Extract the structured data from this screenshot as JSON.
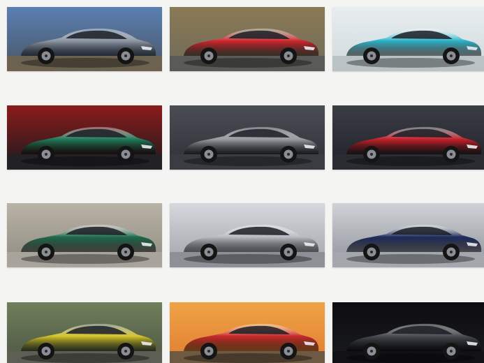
{
  "gallery": {
    "tiles": [
      {
        "subject": "silver-roadster-coast",
        "body": "#8e97a4",
        "bg_top": "#5a7fb3",
        "bg_bottom": "#4b5563",
        "ground": "#6b6250"
      },
      {
        "subject": "red-convertible-supercar",
        "body": "#d3262e",
        "bg_top": "#8a7a55",
        "bg_bottom": "#6f6a5a",
        "ground": "#5a5a56"
      },
      {
        "subject": "teal-electric-race-car",
        "body": "#2bb3c9",
        "bg_top": "#e8eef0",
        "bg_bottom": "#cfd8db",
        "ground": "#b9c3c6"
      },
      {
        "subject": "green-sports-coupe",
        "body": "#1f7d5c",
        "bg_top": "#8a1b1b",
        "bg_bottom": "#1b1b1e",
        "ground": "#222226"
      },
      {
        "subject": "grey-wedge-supercar",
        "body": "#9a9da3",
        "bg_top": "#4a4d55",
        "bg_bottom": "#2e3036",
        "ground": "#3a3c42"
      },
      {
        "subject": "red-supercar-front",
        "body": "#c8202a",
        "bg_top": "#3a3d45",
        "bg_bottom": "#202228",
        "ground": "#2a2c31"
      },
      {
        "subject": "green-sedan",
        "body": "#1c6b4d",
        "bg_top": "#b9b3a6",
        "bg_bottom": "#8f8a80",
        "ground": "#a8a49b"
      },
      {
        "subject": "silver-track-coupe",
        "body": "#b8bcc2",
        "bg_top": "#d5d8dc",
        "bg_bottom": "#9ea3aa",
        "ground": "#8d9097"
      },
      {
        "subject": "navy-sports-coupe",
        "body": "#1d2a5c",
        "bg_top": "#cfd2d6",
        "bg_bottom": "#8e939a",
        "ground": "#a4a8ae"
      },
      {
        "subject": "yellow-open-supercar",
        "body": "#d6c52a",
        "bg_top": "#6f7f5a",
        "bg_bottom": "#4c5443",
        "ground": "#5d5f55"
      },
      {
        "subject": "red-roadster-sunset",
        "body": "#c9282b",
        "bg_top": "#f0a345",
        "bg_bottom": "#e07b30",
        "ground": "#6e5a43"
      },
      {
        "subject": "dark-grey-roadster",
        "body": "#4a4c52",
        "bg_top": "#0d0d10",
        "bg_bottom": "#1b1c20",
        "ground": "#121215"
      }
    ]
  }
}
